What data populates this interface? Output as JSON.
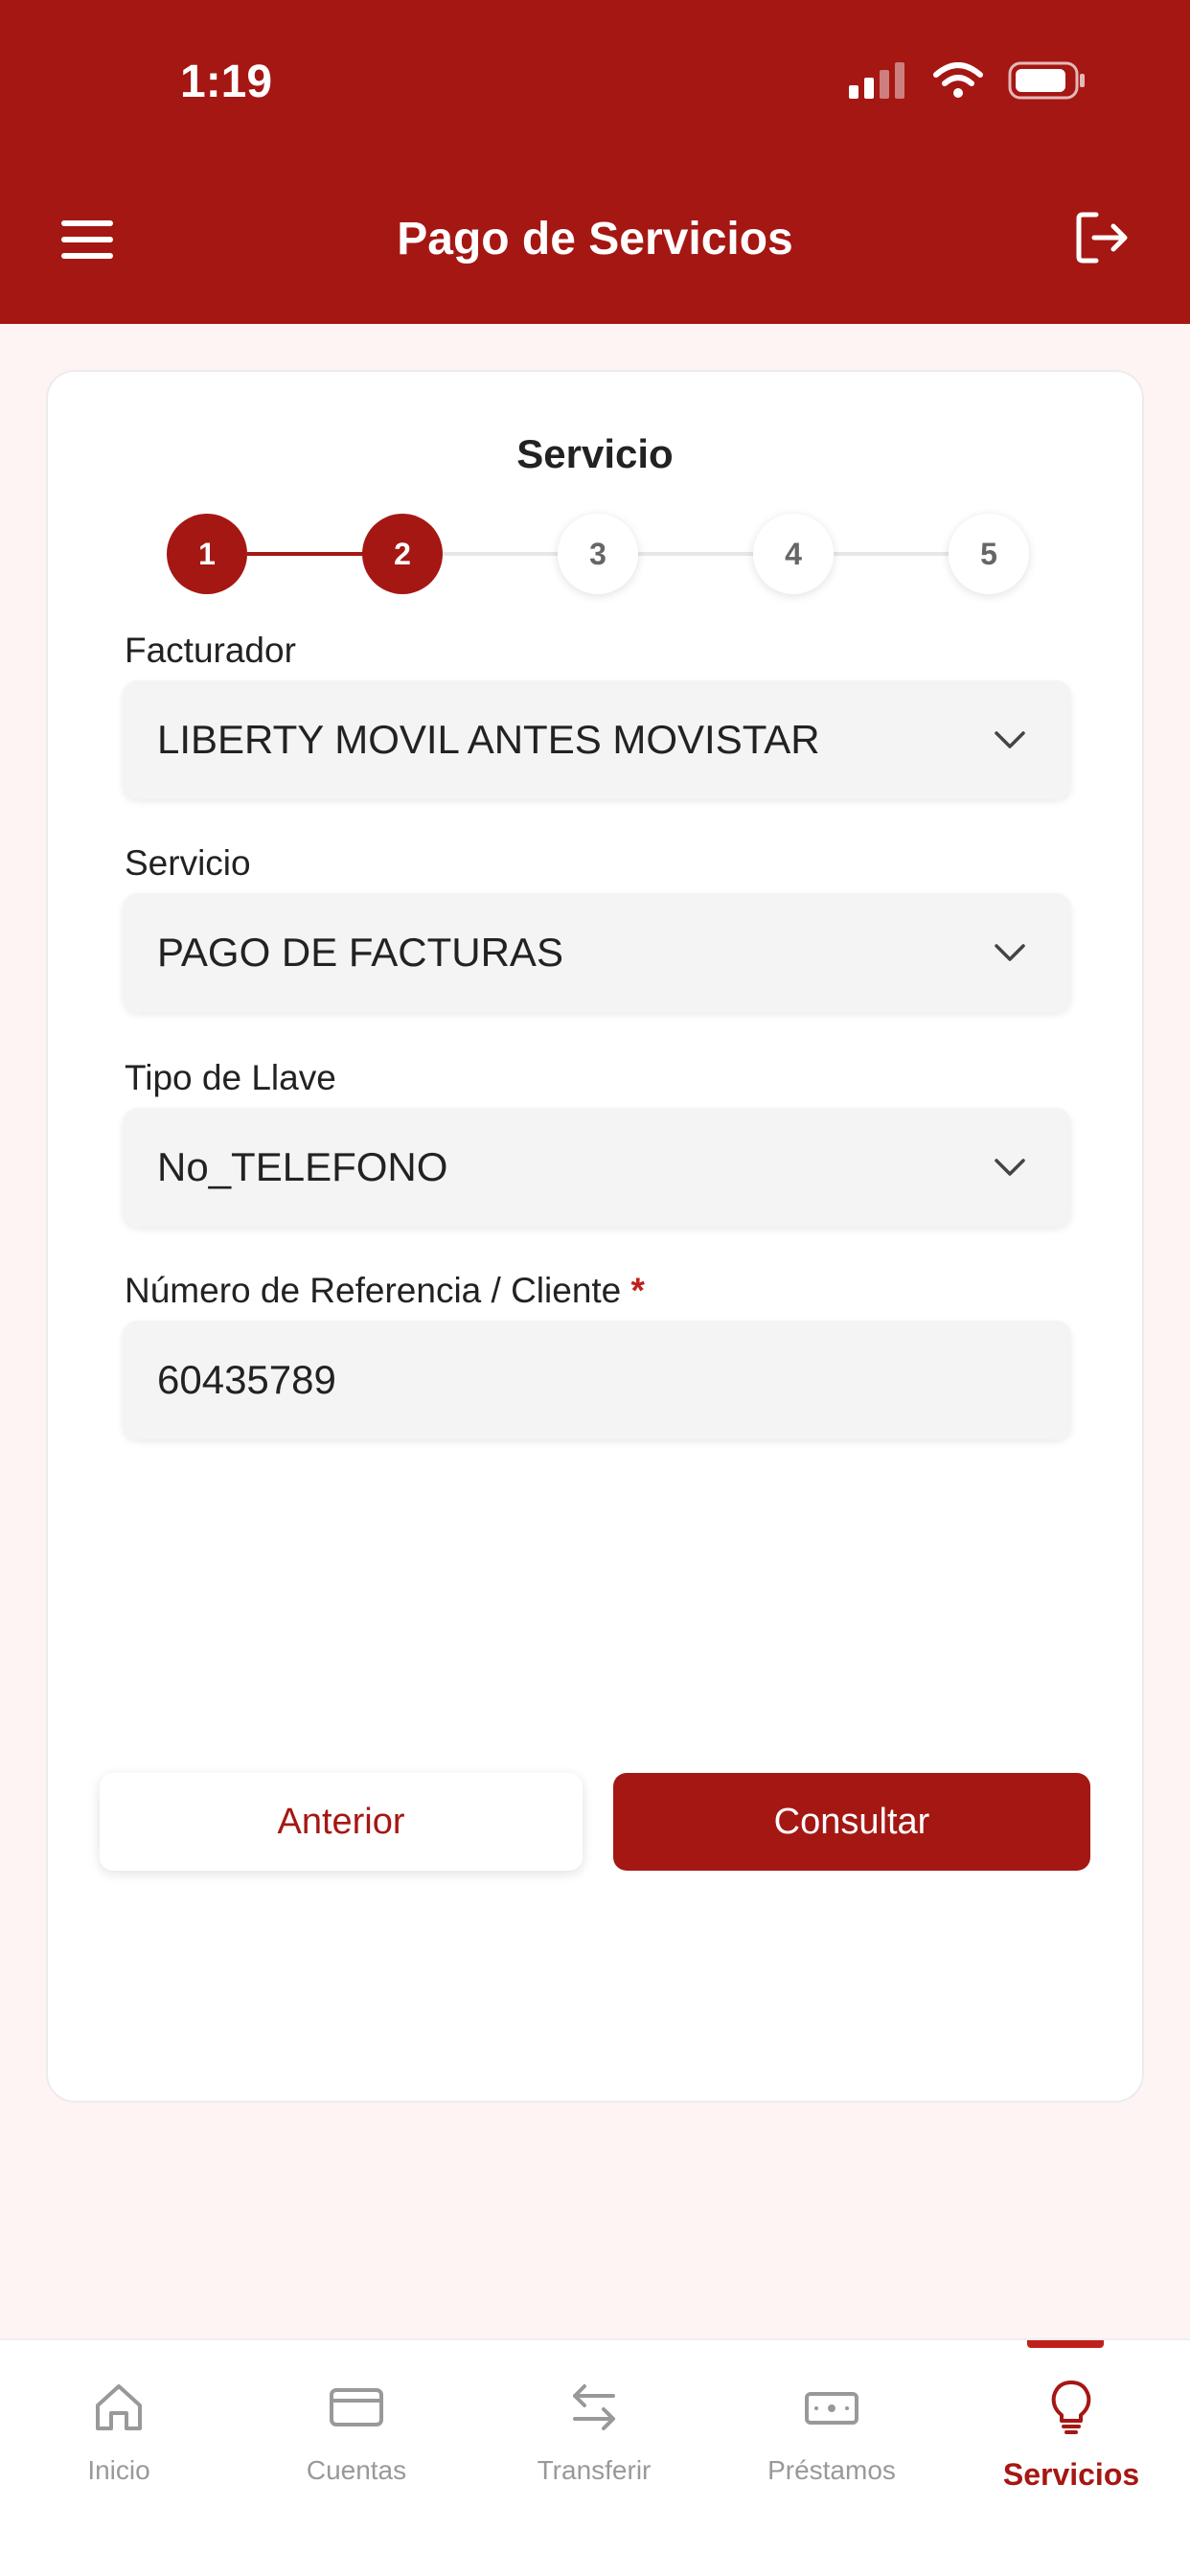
{
  "status_bar": {
    "time": "1:19"
  },
  "header": {
    "title": "Pago de Servicios"
  },
  "card": {
    "title": "Servicio",
    "steps": [
      "1",
      "2",
      "3",
      "4",
      "5"
    ],
    "current_step": 2
  },
  "form": {
    "facturador": {
      "label": "Facturador",
      "value": "LIBERTY MOVIL ANTES MOVISTAR"
    },
    "servicio": {
      "label": "Servicio",
      "value": "PAGO DE FACTURAS"
    },
    "tipo_llave": {
      "label": "Tipo de Llave",
      "value": "No_TELEFONO"
    },
    "referencia": {
      "label": "Número de Referencia / Cliente",
      "required_mark": "*",
      "value": "60435789"
    }
  },
  "actions": {
    "previous": "Anterior",
    "submit": "Consultar"
  },
  "tabbar": {
    "items": [
      {
        "label": "Inicio",
        "icon": "home-icon"
      },
      {
        "label": "Cuentas",
        "icon": "card-icon"
      },
      {
        "label": "Transferir",
        "icon": "transfer-icon"
      },
      {
        "label": "Préstamos",
        "icon": "banknote-icon"
      },
      {
        "label": "Servicios",
        "icon": "lightbulb-icon"
      }
    ],
    "active": "Servicios"
  },
  "colors": {
    "brand": "#a51713",
    "background": "#fdf4f3",
    "inactive": "#999999"
  }
}
